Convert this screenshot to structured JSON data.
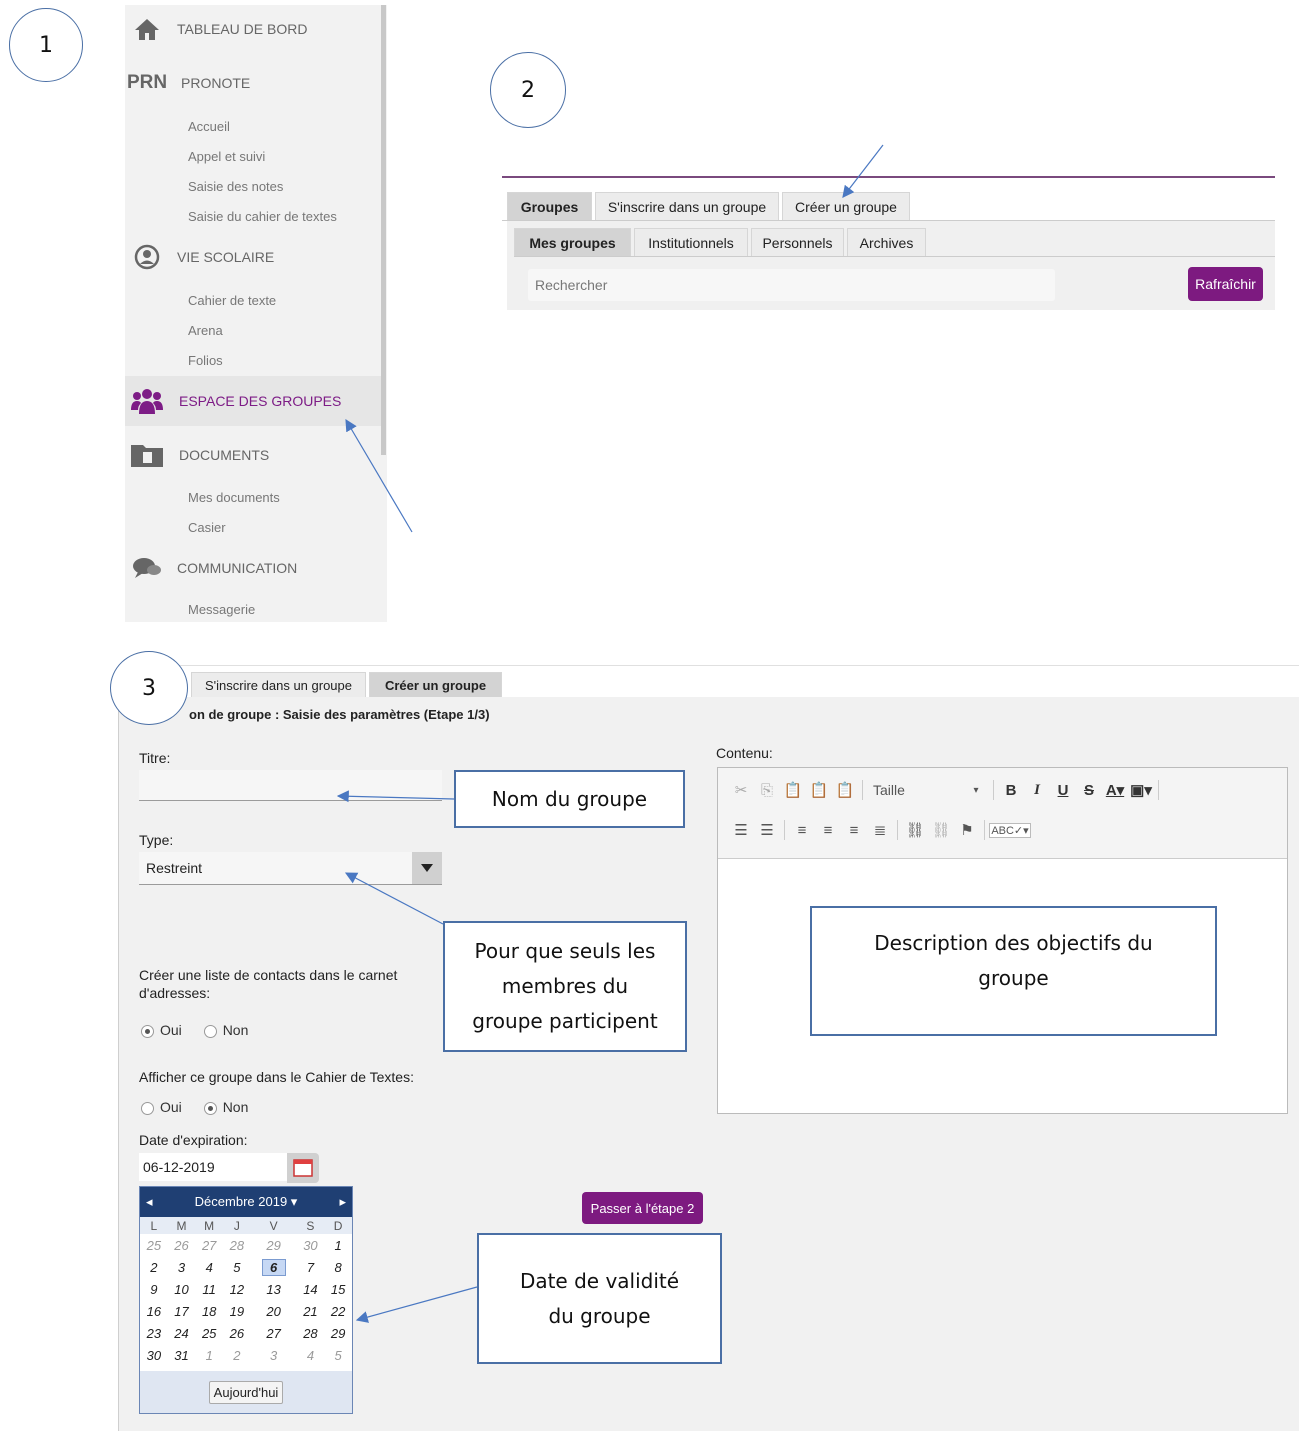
{
  "markers": [
    "1",
    "2",
    "3"
  ],
  "sidebar": {
    "sections": [
      {
        "label": "TABLEAU DE BORD",
        "icon": "home-icon"
      },
      {
        "label": "PRONOTE",
        "icon": "prn-logo"
      },
      {
        "label": "VIE SCOLAIRE",
        "icon": "user-circle-icon"
      },
      {
        "label": "ESPACE DES GROUPES",
        "icon": "groups-icon"
      },
      {
        "label": "DOCUMENTS",
        "icon": "document-icon"
      },
      {
        "label": "COMMUNICATION",
        "icon": "chat-icon"
      }
    ],
    "prn_logo_text": "PRN",
    "pronote_items": [
      "Accueil",
      "Appel et suivi",
      "Saisie des notes",
      "Saisie du cahier de textes"
    ],
    "vie_items": [
      "Cahier de texte",
      "Arena",
      "Folios"
    ],
    "doc_items": [
      "Mes documents",
      "Casier"
    ],
    "comm_items": [
      "Messagerie"
    ],
    "active_color": "#7d1c86"
  },
  "panel2": {
    "tabs": [
      "Groupes",
      "S'inscrire dans un groupe",
      "Créer un groupe"
    ],
    "subtabs": [
      "Mes groupes",
      "Institutionnels",
      "Personnels",
      "Archives"
    ],
    "search_placeholder": "Rechercher",
    "refresh_label": "Rafraîchir"
  },
  "panel3": {
    "tabs": [
      "S'inscrire dans un groupe",
      "Créer un groupe"
    ],
    "heading": "on de groupe : Saisie des paramètres (Etape 1/3)",
    "titre_label": "Titre:",
    "type_label": "Type:",
    "type_value": "Restreint",
    "contacts_label_1": "Créer une liste de contacts dans le carnet",
    "contacts_label_2": "d'adresses:",
    "oui": "Oui",
    "non": "Non",
    "cahier_label": "Afficher ce groupe dans le Cahier de Textes:",
    "date_label": "Date d'expiration:",
    "date_value": "06-12-2019",
    "contenu_label": "Contenu:",
    "taille_label": "Taille",
    "next_button": "Passer à l'étape 2",
    "calendar": {
      "month": "Décembre 2019",
      "weekdays": [
        "L",
        "M",
        "M",
        "J",
        "V",
        "S",
        "D"
      ],
      "weeks": [
        [
          "25",
          "26",
          "27",
          "28",
          "29",
          "30",
          "1"
        ],
        [
          "2",
          "3",
          "4",
          "5",
          "6",
          "7",
          "8"
        ],
        [
          "9",
          "10",
          "11",
          "12",
          "13",
          "14",
          "15"
        ],
        [
          "16",
          "17",
          "18",
          "19",
          "20",
          "21",
          "22"
        ],
        [
          "23",
          "24",
          "25",
          "26",
          "27",
          "28",
          "29"
        ],
        [
          "30",
          "31",
          "1",
          "2",
          "3",
          "4",
          "5"
        ]
      ],
      "today_button": "Aujourd'hui"
    }
  },
  "callouts": {
    "nom": "Nom du groupe",
    "pour_1": "Pour que seuls les",
    "pour_2": "membres du",
    "pour_3": "groupe participent",
    "desc_1": "Description des objectifs du",
    "desc_2": "groupe",
    "date_1": "Date de validité",
    "date_2": "du groupe"
  }
}
